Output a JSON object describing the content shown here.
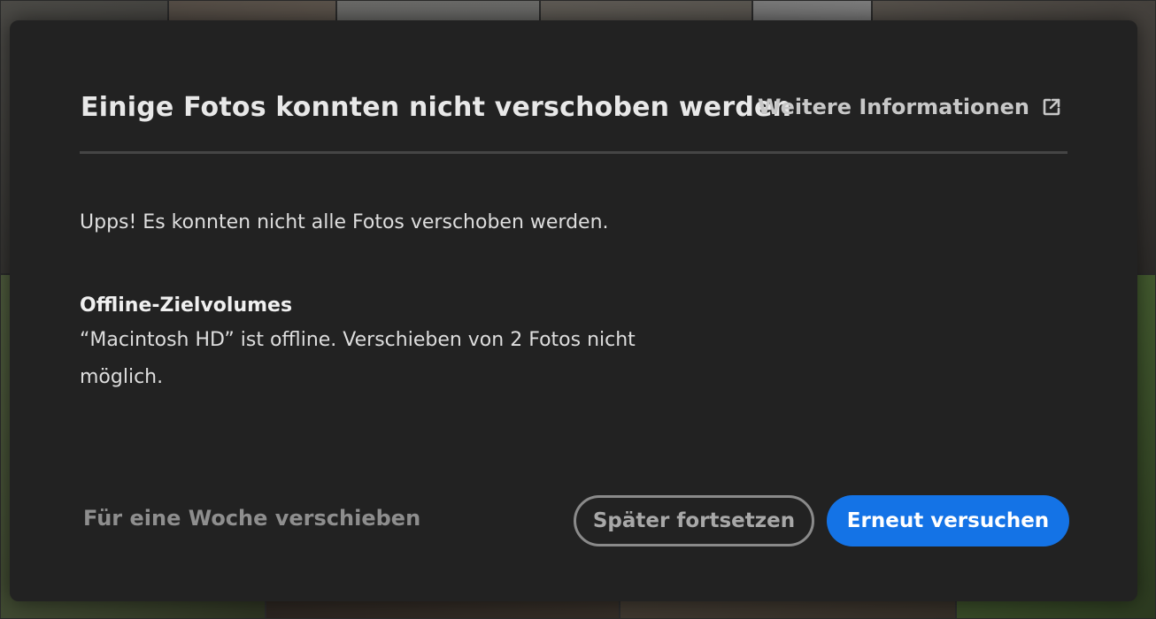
{
  "dialog": {
    "title": "Einige Fotos konnten nicht verschoben werden",
    "info_link": {
      "label": "Weitere Informationen",
      "icon": "external-link-icon"
    },
    "message": "Upps! Es konnten nicht alle Fotos verschoben werden.",
    "section": {
      "heading": "Offline-Zielvolumes",
      "body": "“Macintosh HD” ist offline. Verschieben von 2 Fotos nicht möglich."
    },
    "footer": {
      "postpone_label": "Für eine Woche verschieben",
      "later_label": "Später fortsetzen",
      "retry_label": "Erneut versuchen"
    }
  },
  "colors": {
    "dialog_background": "#222222",
    "primary_button": "#1473e6",
    "secondary_button_border": "#8a8a8a",
    "divider": "#454545"
  }
}
